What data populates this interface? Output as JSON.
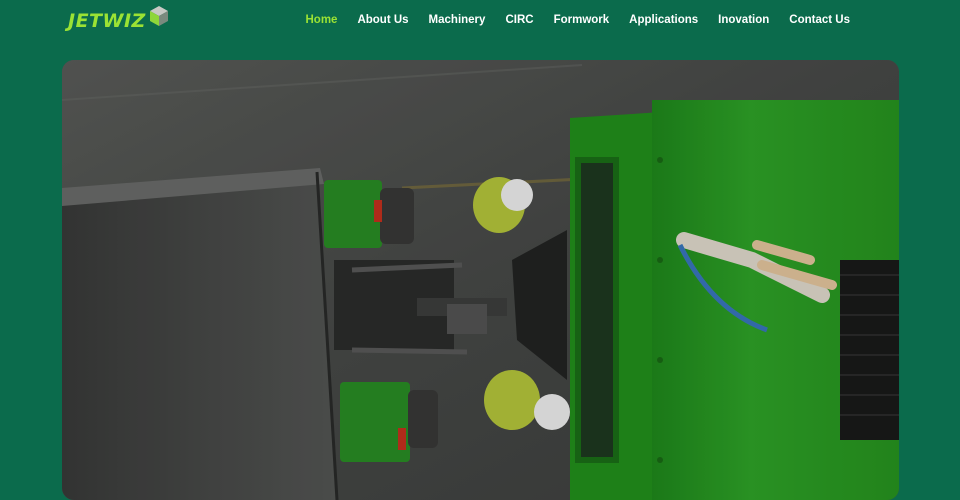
{
  "brand": {
    "name": "JETWIZ",
    "logo_icon": "cube-icon",
    "accent": "#9be234"
  },
  "nav": {
    "items": [
      {
        "label": "Home",
        "active": true
      },
      {
        "label": "About Us"
      },
      {
        "label": "Machinery"
      },
      {
        "label": "CIRC"
      },
      {
        "label": "Formwork"
      },
      {
        "label": "Applications"
      },
      {
        "label": "Inovation"
      },
      {
        "label": "Contact Us"
      }
    ]
  },
  "colors": {
    "background": "#0b6b4c",
    "nav_text": "#ffffff",
    "nav_active": "#9be234"
  }
}
